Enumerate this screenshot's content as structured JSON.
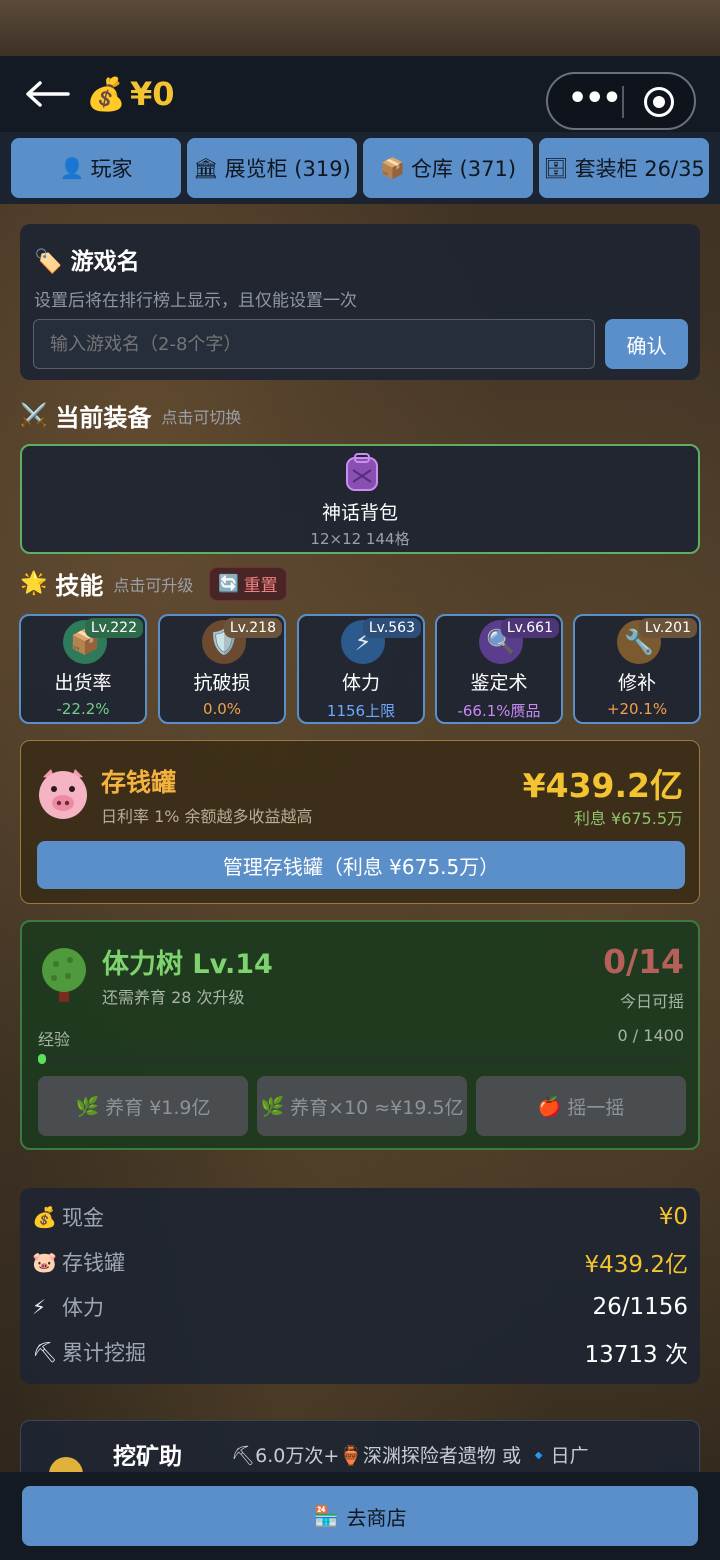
{
  "header": {
    "balance": "¥0",
    "money_icon": "money-bag-icon"
  },
  "tabs": [
    {
      "label": "玩家",
      "icon": "person-icon"
    },
    {
      "label": "展览柜 (319)",
      "icon": "museum-icon"
    },
    {
      "label": "仓库 (371)",
      "icon": "box-icon"
    },
    {
      "label": "套装柜 26/35",
      "icon": "cabinet-icon"
    }
  ],
  "name_card": {
    "title": "游戏名",
    "hint": "设置后将在排行榜上显示，且仅能设置一次",
    "placeholder": "输入游戏名（2-8个字）",
    "confirm": "确认"
  },
  "equipment": {
    "heading": "当前装备",
    "hint": "点击可切换",
    "item_name": "神话背包",
    "item_sub": "12×12 144格"
  },
  "skills_section": {
    "heading": "技能",
    "hint": "点击可升级",
    "reset": "重置"
  },
  "skills": [
    {
      "name": "出货率",
      "level": "Lv.222",
      "value": "-22.2%",
      "value_color": "#6fd08a",
      "icon": "box-icon"
    },
    {
      "name": "抗破损",
      "level": "Lv.218",
      "value": "0.0%",
      "value_color": "#f0a04b",
      "icon": "shield-icon"
    },
    {
      "name": "体力",
      "level": "Lv.563",
      "value": "1156上限",
      "value_color": "#6fa8ff",
      "icon": "lightning-icon"
    },
    {
      "name": "鉴定术",
      "level": "Lv.661",
      "value": "-66.1%赝品",
      "value_color": "#c58af5",
      "icon": "magnifier-icon"
    },
    {
      "name": "修补",
      "level": "Lv.201",
      "value": "+20.1%",
      "value_color": "#f0a04b",
      "icon": "wrench-icon"
    }
  ],
  "piggy": {
    "title": "存钱罐",
    "rate": "日利率 1%  余额越多收益越高",
    "amount": "¥439.2亿",
    "interest": "利息 ¥675.5万",
    "button": "管理存钱罐（利息 ¥675.5万）"
  },
  "tree": {
    "title": "体力树  Lv.14",
    "sub": "还需养育 28 次升级",
    "count": "0/14",
    "today": "今日可摇",
    "exp_label": "经验",
    "exp_value": "0 / 1400",
    "exp_fraction": 0,
    "btn_nurture": "养育 ¥1.9亿",
    "btn_nurture10": "养育×10 ≈¥19.5亿",
    "btn_shake": "摇一摇"
  },
  "stats": [
    {
      "label": "现金",
      "value": "¥0",
      "icon": "money-bag-icon",
      "color": "#f4c430"
    },
    {
      "label": "存钱罐",
      "value": "¥439.2亿",
      "icon": "pig-icon",
      "color": "#f4c430"
    },
    {
      "label": "体力",
      "value": "26/1156",
      "icon": "lightning-icon",
      "color": "#ffffff"
    },
    {
      "label": "累计挖掘",
      "value": "13713 次",
      "icon": "pickaxe-icon",
      "color": "#ffffff"
    }
  ],
  "mining": {
    "title": "挖矿助",
    "desc": "⛏6.0万次+🏺深渊探险者遗物 或 🔹日广"
  },
  "bottom": {
    "shop": "去商店"
  }
}
